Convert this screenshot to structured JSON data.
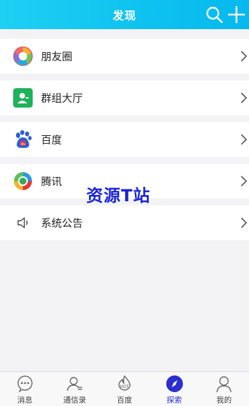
{
  "header": {
    "title": "发现",
    "icons": [
      "search-icon",
      "plus-icon"
    ],
    "gradient": [
      "#1fd0f4",
      "#06b8ee"
    ]
  },
  "discover": {
    "items": [
      {
        "label": "朋友圈",
        "icon": "moments-icon"
      },
      {
        "label": "群组大厅",
        "icon": "group-hall-icon"
      },
      {
        "label": "百度",
        "icon": "baidu-paw-icon"
      },
      {
        "label": "腾讯",
        "icon": "tencent-icon"
      },
      {
        "label": "系统公告",
        "icon": "speaker-icon"
      }
    ]
  },
  "watermark": {
    "text": "资源T站",
    "color": "#1a23d6"
  },
  "tabbar": {
    "active_color": "#2c2fcf",
    "tabs": [
      {
        "label": "消息",
        "icon": "chat-bubble-icon",
        "active": false
      },
      {
        "label": "通信录",
        "icon": "contacts-icon",
        "active": false
      },
      {
        "label": "百度",
        "icon": "hot-icon",
        "active": false
      },
      {
        "label": "探索",
        "icon": "compass-icon",
        "active": true
      },
      {
        "label": "我的",
        "icon": "profile-icon",
        "active": false
      }
    ]
  }
}
